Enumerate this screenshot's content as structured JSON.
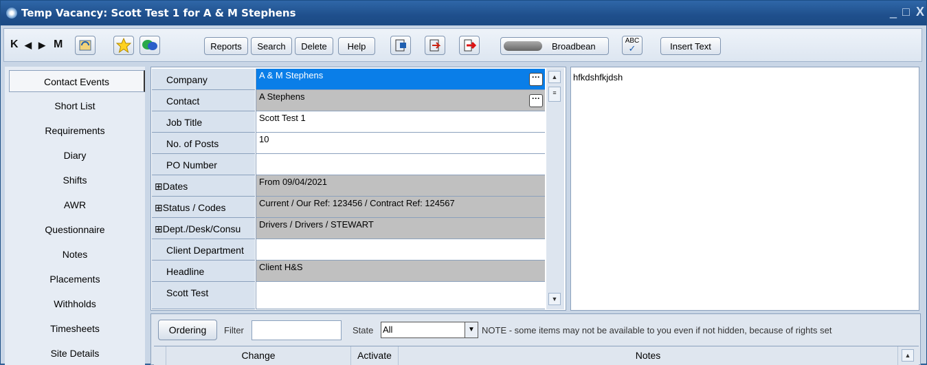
{
  "window": {
    "title": "Temp Vacancy: Scott Test 1 for A & M Stephens",
    "controls": [
      "_",
      "□",
      "X"
    ]
  },
  "toolbar": {
    "nav": [
      "first-icon",
      "prev-icon",
      "next-icon",
      "last-icon"
    ],
    "nav_glyphs": [
      "K",
      "◀",
      "▶",
      "M"
    ],
    "reports_label": "Reports",
    "search_label": "Search",
    "delete_label": "Delete",
    "help_label": "Help",
    "broadbean_label": "Broadbean",
    "spell_label": "ABC",
    "insert_text_label": "Insert Text"
  },
  "sidebar": {
    "items": [
      {
        "label": "Contact Events",
        "active": true
      },
      {
        "label": "Short List"
      },
      {
        "label": "Requirements"
      },
      {
        "label": "Diary"
      },
      {
        "label": "Shifts"
      },
      {
        "label": "AWR"
      },
      {
        "label": "Questionnaire"
      },
      {
        "label": "Notes"
      },
      {
        "label": "Placements"
      },
      {
        "label": "Withholds"
      },
      {
        "label": "Timesheets"
      },
      {
        "label": "Site Details"
      }
    ]
  },
  "form": {
    "rows": [
      {
        "label": "Company",
        "value": "A & M Stephens",
        "style": "blue",
        "lookup": true
      },
      {
        "label": "Contact",
        "value": "A Stephens",
        "style": "grey",
        "lookup": true
      },
      {
        "label": "Job Title",
        "value": "Scott Test 1",
        "style": "white"
      },
      {
        "label": "No. of Posts",
        "value": "10",
        "style": "white"
      },
      {
        "label": "PO Number",
        "value": "",
        "style": "white"
      },
      {
        "label": "Dates",
        "value": "From 09/04/2021",
        "style": "grey",
        "expand": true
      },
      {
        "label": "Status / Codes",
        "value": "Current / Our Ref: 123456 / Contract Ref: 124567",
        "style": "grey",
        "expand": true
      },
      {
        "label": "Dept./Desk/Consu",
        "value": "Drivers / Drivers / STEWART",
        "style": "grey",
        "expand": true
      },
      {
        "label": "Client Department",
        "value": "",
        "style": "white"
      },
      {
        "label": "Headline",
        "value": "Client H&S",
        "style": "grey"
      },
      {
        "label": "Scott Test",
        "value": "",
        "style": "white"
      }
    ],
    "expand_glyph": "⊞",
    "lookup_glyph": "···"
  },
  "notes_text": "hfkdshfkjdsh",
  "bottom": {
    "ordering_label": "Ordering",
    "filter_label": "Filter",
    "filter_value": "",
    "state_label": "State",
    "state_value": "All",
    "note": "NOTE - some items may not be available to you even if not hidden, because of rights set",
    "columns": [
      "Change",
      "Activate",
      "Notes"
    ]
  },
  "colors": {
    "titlebar": "#1f4f8c",
    "selected_field": "#0a7ee8",
    "readonly_field": "#c0c0c0"
  }
}
